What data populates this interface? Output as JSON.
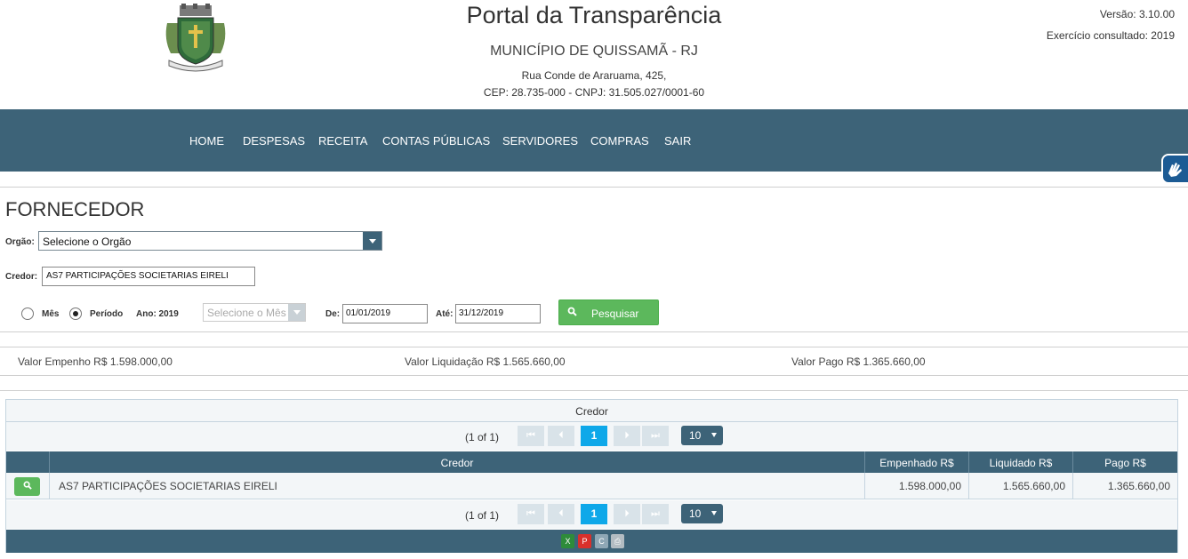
{
  "header": {
    "title": "Portal da Transparência",
    "municipio": "MUNICÍPIO DE QUISSAMÃ - RJ",
    "address_line1": "Rua Conde de Araruama, 425,",
    "address_line2": "CEP: 28.735-000 - CNPJ: 31.505.027/0001-60",
    "versao": "Versão: 3.10.00",
    "exercicio": "Exercício consultado: 2019"
  },
  "nav": {
    "items": [
      "HOME",
      "DESPESAS",
      "RECEITA",
      "CONTAS PÚBLICAS",
      "SERVIDORES",
      "COMPRAS",
      "SAIR"
    ]
  },
  "page": {
    "title": "FORNECEDOR"
  },
  "filters": {
    "orgao_label": "Orgão:",
    "orgao_value": "Selecione o Orgão",
    "credor_label": "Credor:",
    "credor_value": "AS7 PARTICIPAÇÕES SOCIETARIAS EIRELI",
    "radio_mes_label": "Mês",
    "radio_periodo_label": "Período",
    "selected_radio": "Período",
    "ano_label": "Ano: 2019",
    "mes_placeholder": "Selecione o Mês",
    "de_label": "De:",
    "de_value": "01/01/2019",
    "ate_label": "Até:",
    "ate_value": "31/12/2019",
    "search_button_label": "Pesquisar"
  },
  "totals": {
    "empenho_label": "Valor Empenho R$",
    "empenho_value": "1.598.000,00",
    "liquidacao_label": "Valor Liquidação R$",
    "liquidacao_value": "1.565.660,00",
    "pago_label": "Valor Pago R$",
    "pago_value": "1.365.660,00"
  },
  "grid": {
    "caption": "Credor",
    "pager": {
      "page_count_text": "(1 of 1)",
      "current_page": "1",
      "rows_per_page": "10"
    },
    "columns": [
      "Credor",
      "Empenhado R$",
      "Liquidado R$",
      "Pago R$"
    ],
    "rows": [
      {
        "credor": "AS7 PARTICIPAÇÕES SOCIETARIAS EIRELI",
        "empenhado": "1.598.000,00",
        "liquidado": "1.565.660,00",
        "pago": "1.365.660,00"
      }
    ],
    "export_icons": [
      "excel-icon",
      "pdf-icon",
      "csv-icon",
      "print-icon"
    ]
  },
  "colors": {
    "navbar": "#3d6378",
    "accent_green": "#5cb85c",
    "active_page": "#0ea8e9"
  }
}
